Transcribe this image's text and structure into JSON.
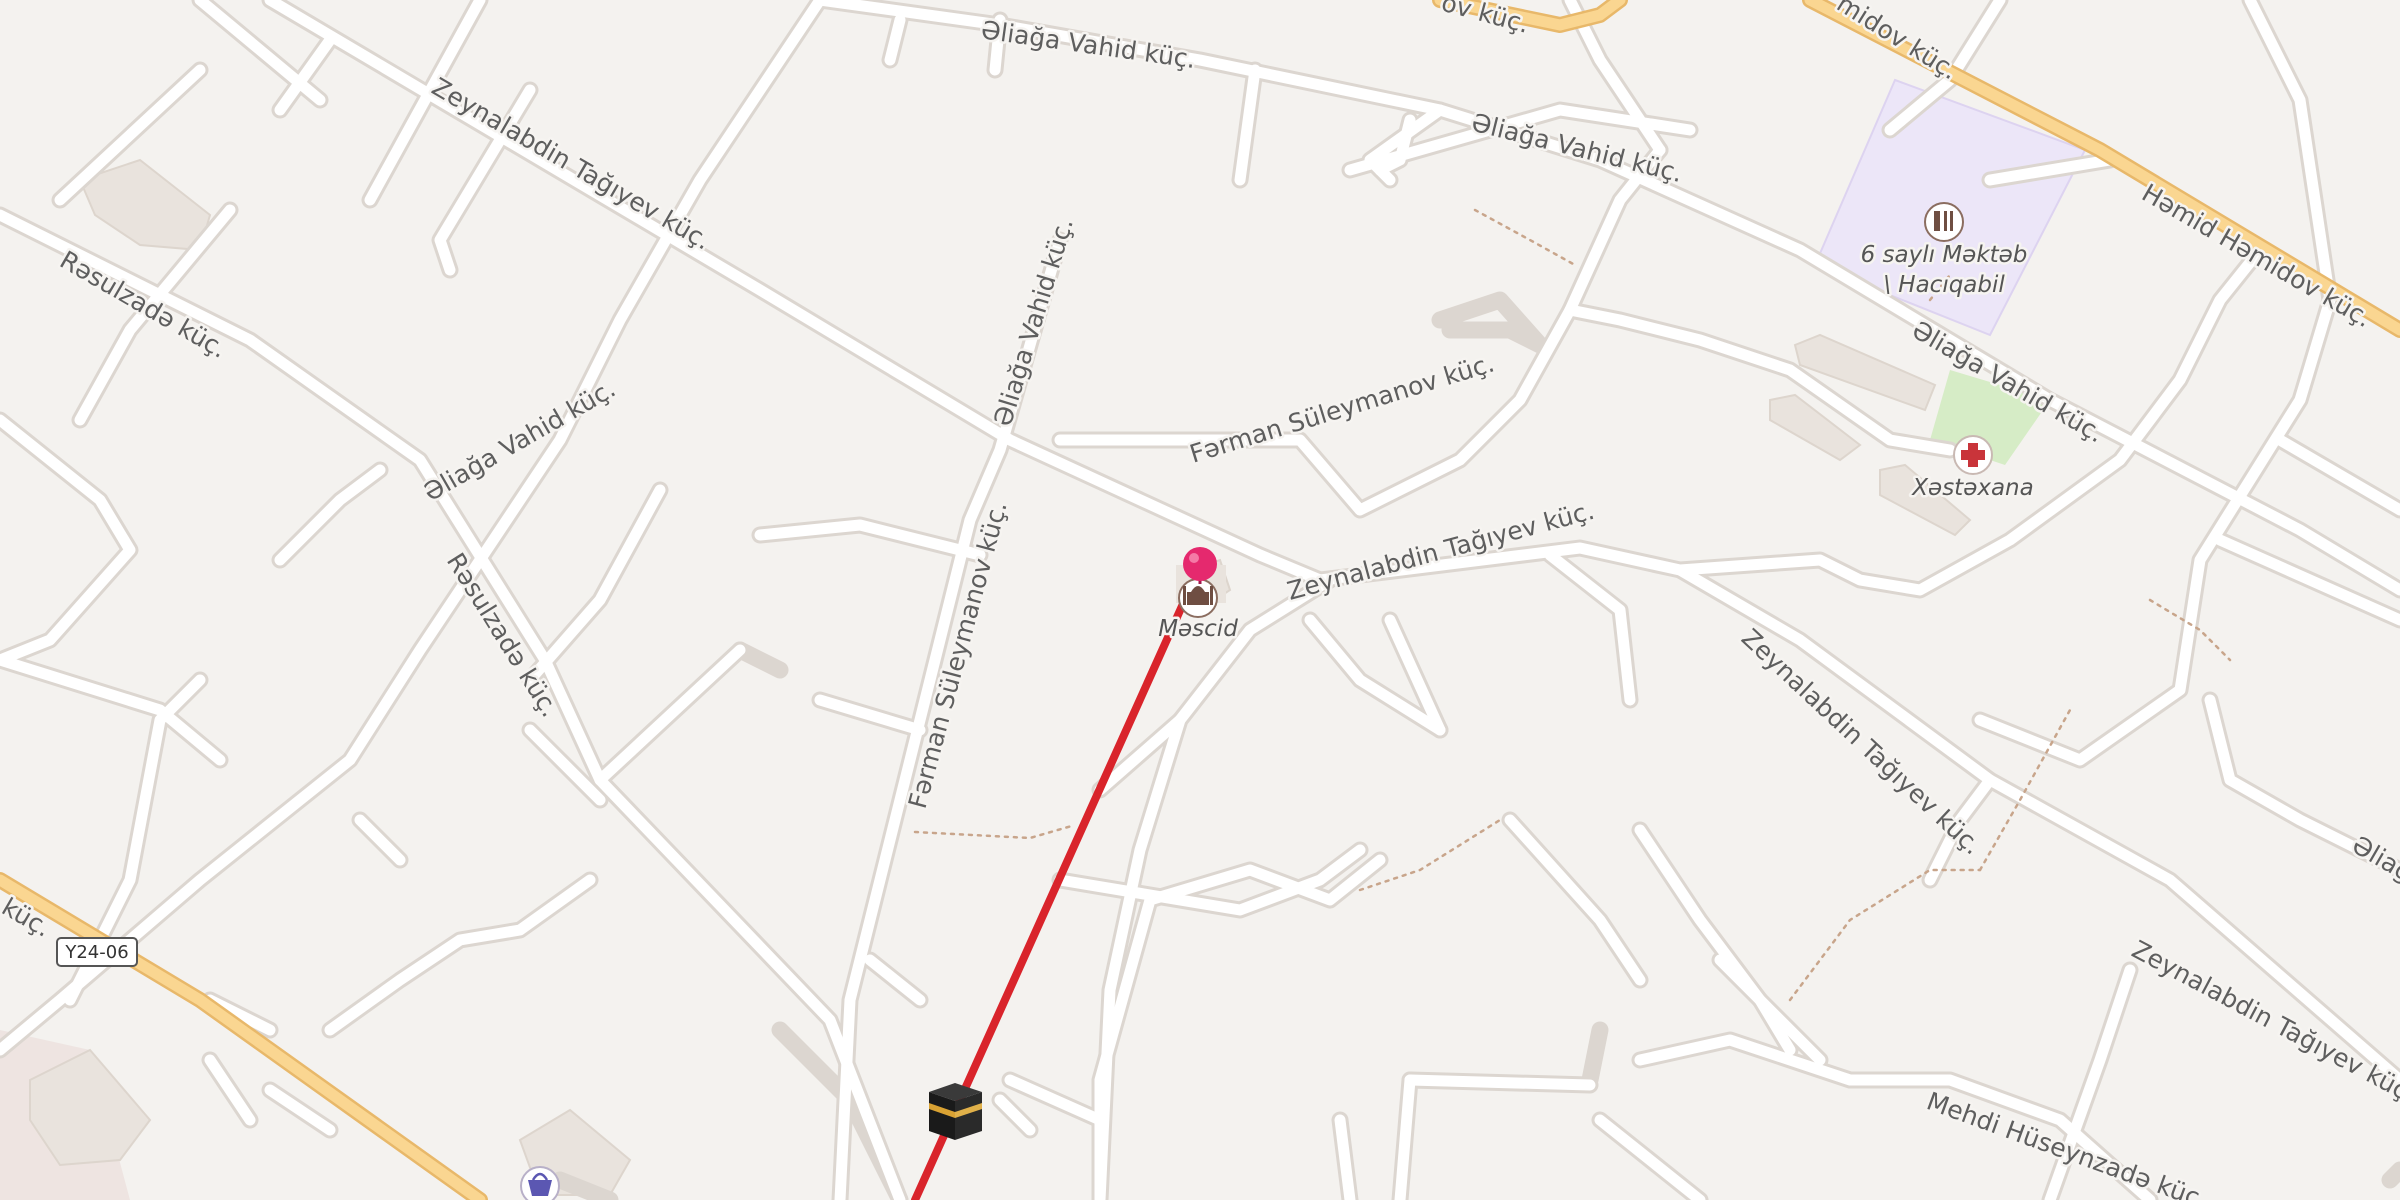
{
  "map": {
    "colors": {
      "background": "#f4f2ef",
      "route": "#d9242b",
      "pin": "#e5296e",
      "school_area": "#ece6f8",
      "park_area": "#d6ecc6",
      "primary_road": "#fad691"
    },
    "streets": {
      "aliaga_vahid_1": "Əliağa Vahid küç.",
      "aliaga_vahid_2": "Əliağa Vahid küç.",
      "aliaga_vahid_3": "Əliağa Vahid küç.",
      "aliaga_vahid_4": "Əliağa Vahid küç.",
      "aliaga_vahid_5": "Əliağa Vahid küç.",
      "aliaga_vahid_edge": "Əliağ",
      "hamid_hamidov_1": "Həmid Həmidov küç.",
      "hamid_hamidov_top": "midov küç.",
      "top_fragment": "ov küç.",
      "zeynalabdin_1": "Zeynalabdin Tağıyev küç.",
      "zeynalabdin_2": "Zeynalabdin Tağıyev küç.",
      "zeynalabdin_3": "Zeynalabdin Tağıyev küç.",
      "zeynalabdin_4": "Zeynalabdin Tağıyev küç.",
      "rasulzada_1": "Rəsulzadə küç.",
      "rasulzada_2": "Rəsulzadə küç.",
      "farman_1": "Fərman Süleymanov küç.",
      "farman_2": "Fərman Süleymanov küç.",
      "mehdi": "Mehdi Hüseynzadə küç.",
      "left_fragment": "küç."
    },
    "shield": "Y24-06",
    "pois": {
      "mosque": {
        "label": "Məscid",
        "icon": "mosque-icon"
      },
      "school": {
        "label_line1": "6 saylı Məktəb",
        "label_line2": "\\ Hacıqabil",
        "icon": "school-icon"
      },
      "hospital": {
        "label": "Xəstəxana",
        "icon": "hospital-cross-icon"
      },
      "shop": {
        "icon": "shopping-basket-icon"
      },
      "kaaba": {
        "icon": "kaaba-icon"
      }
    },
    "markers": {
      "destination": "pin-marker-icon"
    },
    "route": {
      "direction": "qibla",
      "from": "mosque",
      "toward": "kaaba"
    }
  }
}
